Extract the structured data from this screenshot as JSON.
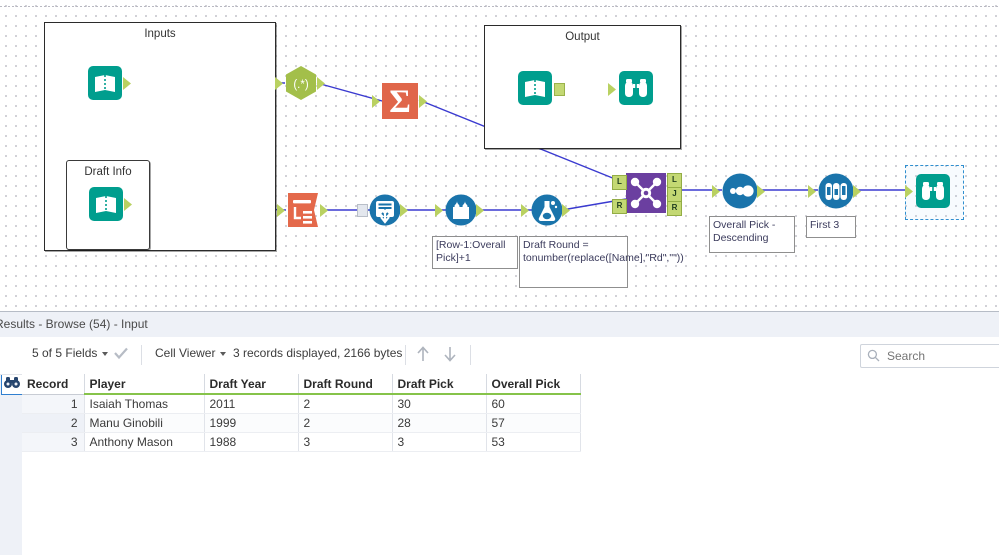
{
  "app": "Alteryx Designer Workflow Canvas",
  "canvas": {
    "containers": [
      {
        "name": "inputs",
        "title": "Inputs"
      },
      {
        "name": "draft-info",
        "title": "Draft Info"
      },
      {
        "name": "output",
        "title": "Output"
      }
    ],
    "tools": [
      {
        "name": "input-data-inputs",
        "icon": "input-data-icon",
        "label": ""
      },
      {
        "name": "regex",
        "icon": "regex-icon",
        "label": "(.*)"
      },
      {
        "name": "summarize",
        "icon": "summarize-icon",
        "label": "Σ"
      },
      {
        "name": "input-data-output",
        "icon": "input-data-icon",
        "label": ""
      },
      {
        "name": "browse-output",
        "icon": "browse-icon",
        "label": ""
      },
      {
        "name": "input-data-draft-info",
        "icon": "input-data-icon",
        "label": ""
      },
      {
        "name": "text-to-columns",
        "icon": "text-to-columns-icon",
        "label": ""
      },
      {
        "name": "record-id",
        "icon": "record-id-icon",
        "label": ""
      },
      {
        "name": "multi-row-formula",
        "icon": "multi-row-formula-icon",
        "label": ""
      },
      {
        "name": "formula",
        "icon": "formula-flask-icon",
        "label": ""
      },
      {
        "name": "join",
        "icon": "join-icon",
        "label": ""
      },
      {
        "name": "sort",
        "icon": "sort-icon",
        "label": ""
      },
      {
        "name": "sample",
        "icon": "sample-icon",
        "label": ""
      },
      {
        "name": "browse-final",
        "icon": "browse-icon",
        "label": ""
      }
    ],
    "join_anchors": {
      "left_in": "L",
      "right_in": "R",
      "left_out": "L",
      "join_out": "J",
      "right_out": "R"
    },
    "annotations": [
      {
        "name": "anno-multi-row-formula",
        "text": "[Row-1:Overall Pick]+1"
      },
      {
        "name": "anno-formula",
        "text": "Draft Round = tonumber(replace([Name],\"Rd\",\"\"))"
      },
      {
        "name": "anno-sort",
        "text": "Overall Pick - Descending"
      },
      {
        "name": "anno-sample",
        "text": "First 3"
      }
    ],
    "colors": {
      "input_teal": "#009e8e",
      "regex_green": "#a3bf4a",
      "summarize_red": "#e0664a",
      "text_to_columns_orange": "#e4694b",
      "blue_tool": "#1a74ab",
      "join_purple": "#6b3fa0",
      "anchor_green": "#b9d161",
      "wire_blue": "#3a3ad0",
      "selection_blue": "#2f8fd0"
    }
  },
  "results": {
    "title": "Results - Browse (54) - Input",
    "toolbar": {
      "fields_label": "5 of 5 Fields",
      "check_icon": "check-icon",
      "cell_viewer_label": "Cell Viewer",
      "records_label": "3 records displayed, 2166 bytes",
      "up_arrow_icon": "arrow-up-icon",
      "down_arrow_icon": "arrow-down-icon",
      "search_placeholder": "Search",
      "search_value": "",
      "search_icon": "search-icon"
    },
    "rail": [
      {
        "name": "rail-metadata",
        "icon": "list-lines-icon",
        "active": false
      },
      {
        "name": "rail-browse",
        "icon": "browse-binoculars-icon",
        "active": true
      }
    ],
    "grid": {
      "columns": [
        "Record",
        "Player",
        "Draft Year",
        "Draft Round",
        "Draft Pick",
        "Overall Pick"
      ],
      "rows": [
        {
          "record": "1",
          "player": "Isaiah Thomas",
          "draft_year": "2011",
          "draft_round": "2",
          "draft_pick": "30",
          "overall_pick": "60"
        },
        {
          "record": "2",
          "player": "Manu Ginobili",
          "draft_year": "1999",
          "draft_round": "2",
          "draft_pick": "28",
          "overall_pick": "57"
        },
        {
          "record": "3",
          "player": "Anthony Mason",
          "draft_year": "1988",
          "draft_round": "3",
          "draft_pick": "3",
          "overall_pick": "53"
        }
      ]
    }
  }
}
